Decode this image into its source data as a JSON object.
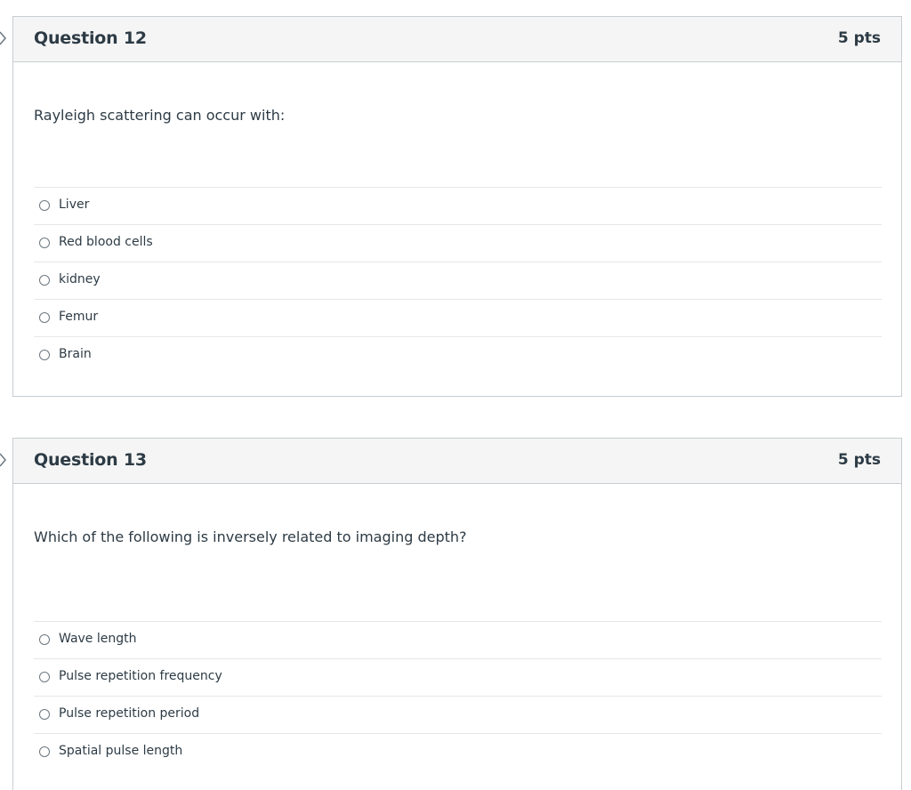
{
  "questions": [
    {
      "title": "Question 12",
      "points": "5 pts",
      "text": "Rayleigh scattering can occur with:",
      "answers": [
        "Liver",
        "Red blood cells",
        "kidney",
        "Femur",
        "Brain"
      ]
    },
    {
      "title": "Question 13",
      "points": "5 pts",
      "text": "Which of the following is inversely related to imaging depth?",
      "answers": [
        "Wave length",
        "Pulse repetition frequency",
        "Pulse repetition period",
        "Spatial pulse length"
      ]
    }
  ],
  "icons": {
    "question_marker": "chevron-right-icon",
    "answer_radio": "radio-unchecked-icon"
  },
  "colors": {
    "text": "#2d3b45",
    "border": "#c7cdd1",
    "header_bg": "#f5f5f5",
    "divider": "#e4e7e9"
  }
}
